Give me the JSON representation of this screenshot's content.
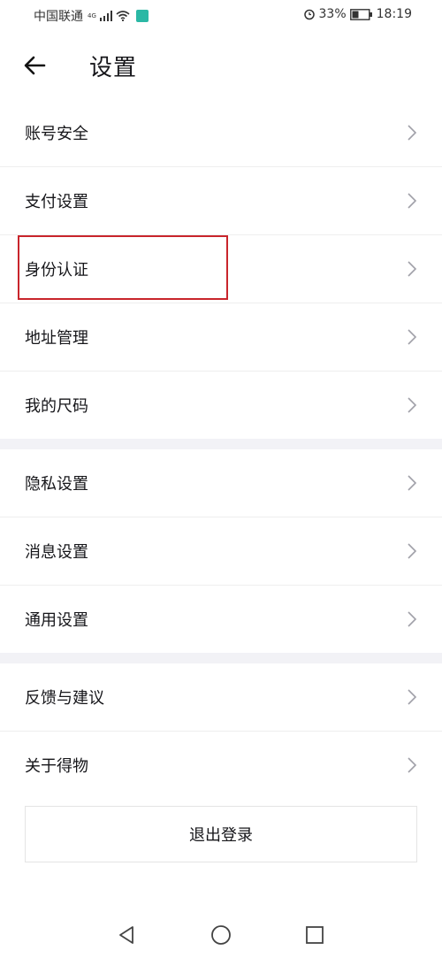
{
  "status_bar": {
    "carrier": "中国联通",
    "network": "4G",
    "battery_percent": "33%",
    "time": "18:19",
    "icons": [
      "signal-icon",
      "wifi-icon",
      "mi-app-icon",
      "alarm-icon",
      "battery-icon"
    ]
  },
  "header": {
    "title": "设置",
    "back_icon": "arrow-left-icon"
  },
  "groups": [
    {
      "items": [
        {
          "label": "账号安全"
        },
        {
          "label": "支付设置"
        },
        {
          "label": "身份认证"
        },
        {
          "label": "地址管理"
        },
        {
          "label": "我的尺码"
        }
      ]
    },
    {
      "items": [
        {
          "label": "隐私设置"
        },
        {
          "label": "消息设置"
        },
        {
          "label": "通用设置"
        }
      ]
    },
    {
      "items": [
        {
          "label": "反馈与建议"
        },
        {
          "label": "关于得物"
        }
      ]
    }
  ],
  "logout_label": "退出登录",
  "highlight_color": "#c9252c",
  "nav": [
    "back-triangle-icon",
    "home-circle-icon",
    "recent-square-icon"
  ]
}
